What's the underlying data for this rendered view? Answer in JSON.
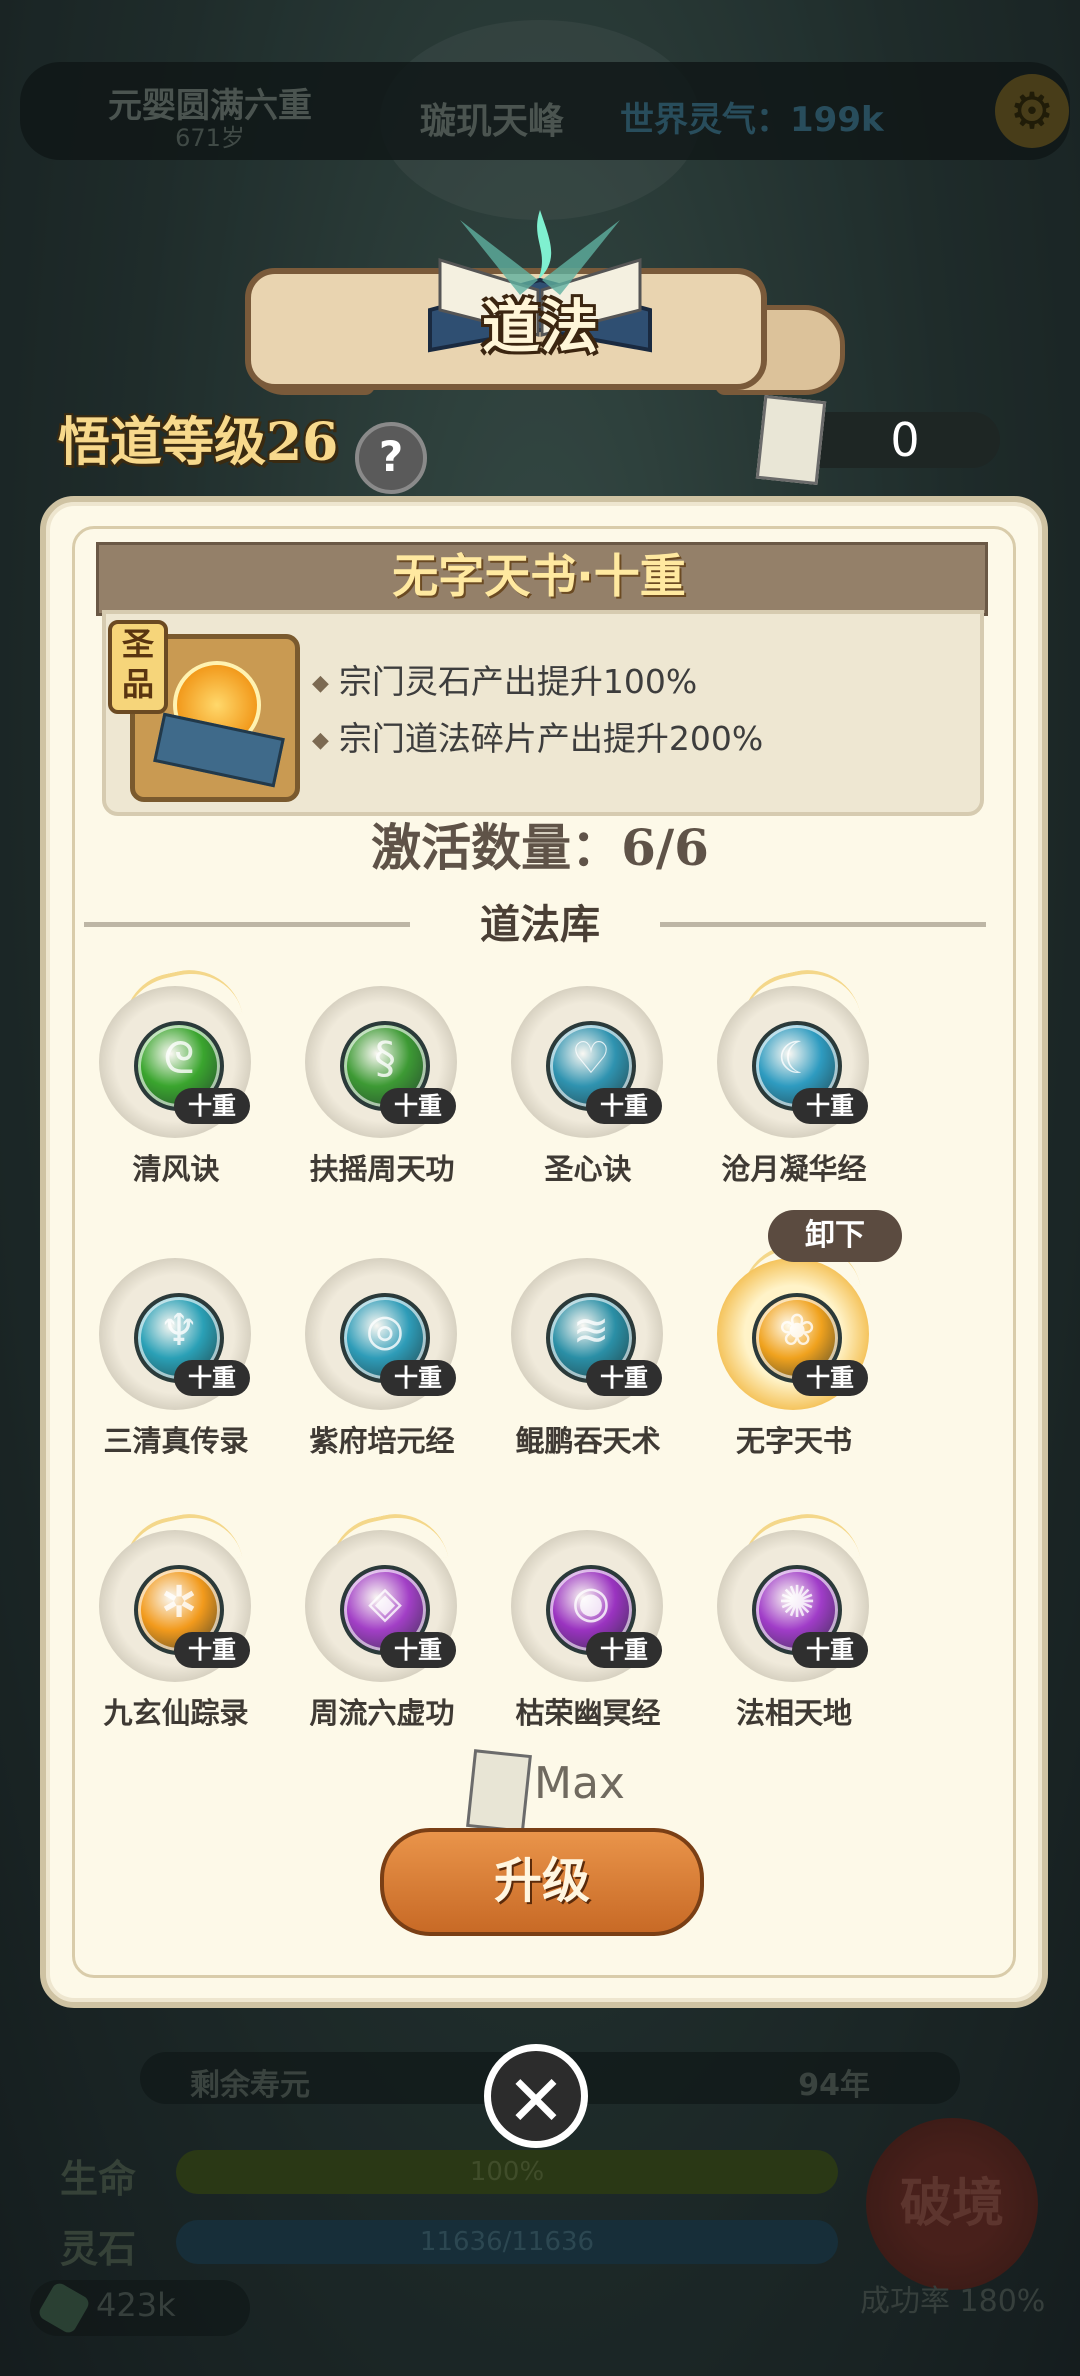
{
  "topbar": {
    "realm": "元婴圆满六重",
    "age": "671岁",
    "sect": "璇玑天峰",
    "aura": "世界灵气：199k",
    "settings_icon": "gear-icon"
  },
  "header": {
    "title": "道法"
  },
  "level": {
    "label": "悟道等级26",
    "help": "?"
  },
  "fragments": {
    "count": "0"
  },
  "selected": {
    "title": "无字天书·十重",
    "grade": "圣品",
    "effects": [
      "宗门灵石产出提升100%",
      "宗门道法碎片产出提升200%"
    ]
  },
  "active_count": "激活数量：6/6",
  "library": {
    "title": "道法库",
    "unequip_label": "卸下",
    "skills": [
      {
        "name": "清风诀",
        "tag": "十重",
        "color": "#3aa52e",
        "glyph": "ᘓ"
      },
      {
        "name": "扶摇周天功",
        "tag": "十重",
        "color": "#3d9a34",
        "glyph": "§"
      },
      {
        "name": "圣心诀",
        "tag": "十重",
        "color": "#2f93b0",
        "glyph": "♡"
      },
      {
        "name": "沧月凝华经",
        "tag": "十重",
        "color": "#2e9bc0",
        "glyph": "☾"
      },
      {
        "name": "三清真传录",
        "tag": "十重",
        "color": "#2aa0b6",
        "glyph": "♆"
      },
      {
        "name": "紫府培元经",
        "tag": "十重",
        "color": "#2e9cb8",
        "glyph": "◎"
      },
      {
        "name": "鲲鹏吞天术",
        "tag": "十重",
        "color": "#2a8fa6",
        "glyph": "≋"
      },
      {
        "name": "无字天书",
        "tag": "十重",
        "color": "#f0a21e",
        "glyph": "❀"
      },
      {
        "name": "九玄仙踪录",
        "tag": "十重",
        "color": "#f29a1c",
        "glyph": "✲"
      },
      {
        "name": "周流六虚功",
        "tag": "十重",
        "color": "#a23fc6",
        "glyph": "◈"
      },
      {
        "name": "枯荣幽冥经",
        "tag": "十重",
        "color": "#9a33c0",
        "glyph": "◉"
      },
      {
        "name": "法相天地",
        "tag": "十重",
        "color": "#a03cc8",
        "glyph": "✺"
      }
    ]
  },
  "upgrade": {
    "cost": "Max",
    "button": "升级"
  },
  "bottom": {
    "remain_label": "剩余寿元",
    "remain_value": "94年",
    "life_label": "生命",
    "life_value": "100%",
    "stone_label": "灵石",
    "stone_value": "11636/11636",
    "gems": "423k",
    "breach": "破境",
    "rate": "成功率 180%"
  },
  "close_icon": "close-icon"
}
